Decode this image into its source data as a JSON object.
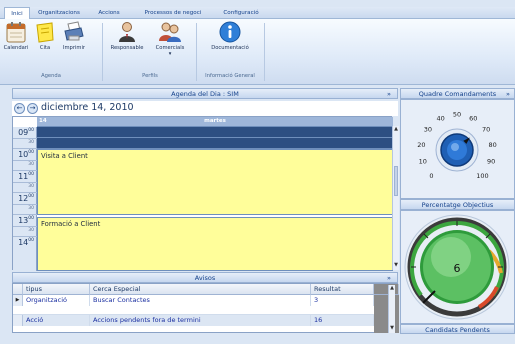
{
  "ribbon": {
    "tabs": [
      "Inici",
      "Organitzacions",
      "Accions",
      "Processos de negoci",
      "Configuració"
    ],
    "groups": [
      {
        "label": "Agenda",
        "buttons": [
          "Calendari",
          "Cita",
          "Imprimir"
        ]
      },
      {
        "label": "Perfils",
        "buttons": [
          "Responsable",
          "Comercials"
        ]
      },
      {
        "label": "Informació General",
        "buttons": [
          "Documentació"
        ]
      }
    ]
  },
  "agenda": {
    "header": "Agenda del Dia : SIM",
    "chevron": "»",
    "prev": "←",
    "next": "→",
    "date": "diciembre 14, 2010",
    "day_number": "14",
    "day_name": "martes",
    "hours": [
      {
        "h": "09",
        "m": "30"
      },
      {
        "h": "10",
        "m": "30"
      },
      {
        "h": "11",
        "m": "30"
      },
      {
        "h": "12",
        "m": "30"
      },
      {
        "h": "13",
        "m": "30"
      },
      {
        "h": "14",
        "m": ""
      }
    ],
    "minute_suffix": "00",
    "appointments": [
      "Visita a Client",
      "Formació a Client"
    ]
  },
  "avisos": {
    "header": "Avisos",
    "chevron": "»",
    "columns": [
      "tipus",
      "Cerca Especial",
      "Resultat"
    ],
    "rows": [
      {
        "tipus": "Organització",
        "cerca": "Buscar Contactes",
        "resultat": "3",
        "selected": true
      },
      {
        "tipus": "Acció",
        "cerca": "Accions pendents fora de termini",
        "resultat": "16",
        "selected": false
      }
    ]
  },
  "quadre": {
    "header": "Quadre Comandaments",
    "chevron": "»",
    "dial_ticks": [
      "0",
      "10",
      "20",
      "30",
      "40",
      "50",
      "60",
      "70",
      "80",
      "90",
      "100"
    ],
    "dial_value": 67
  },
  "objectius": {
    "header": "Percentatge Objectius",
    "value": "6"
  },
  "candidats": {
    "label": "Candidats Pendents"
  },
  "colors": {
    "ribbon_text": "#15428b",
    "appointment": "#fffe9a",
    "calendar_dark": "#2d4f82",
    "gauge_green": "#2e9b3b"
  }
}
